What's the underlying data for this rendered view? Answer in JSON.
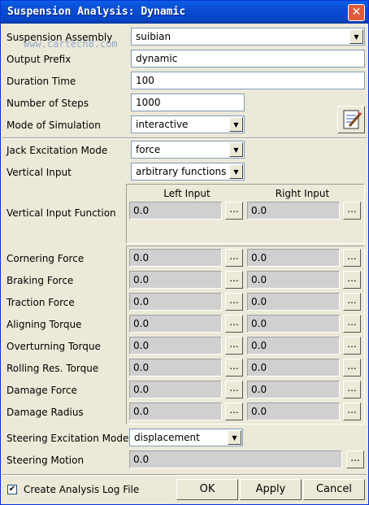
{
  "window": {
    "title": "Suspension Analysis: Dynamic",
    "close_glyph": "✕"
  },
  "watermark": "www.cartech8.com",
  "form": {
    "suspension_assembly": {
      "label": "Suspension Assembly",
      "value": "suibian"
    },
    "output_prefix": {
      "label": "Output Prefix",
      "value": "dynamic"
    },
    "duration_time": {
      "label": "Duration Time",
      "value": "100"
    },
    "number_of_steps": {
      "label": "Number of Steps",
      "value": "1000"
    },
    "mode_of_simulation": {
      "label": "Mode of Simulation",
      "value": "interactive"
    },
    "jack_excitation_mode": {
      "label": "Jack Excitation Mode",
      "value": "force"
    },
    "vertical_input": {
      "label": "Vertical Input",
      "value": "arbitrary functions"
    },
    "vertical_input_function": {
      "label": "Vertical Input Function",
      "left": "0.0",
      "right": "0.0"
    },
    "columns": {
      "left": "Left Input",
      "right": "Right Input"
    },
    "loads": [
      {
        "label": "Cornering Force",
        "left": "0.0",
        "right": "0.0"
      },
      {
        "label": "Braking Force",
        "left": "0.0",
        "right": "0.0"
      },
      {
        "label": "Traction Force",
        "left": "0.0",
        "right": "0.0"
      },
      {
        "label": "Aligning Torque",
        "left": "0.0",
        "right": "0.0"
      },
      {
        "label": "Overturning Torque",
        "left": "0.0",
        "right": "0.0"
      },
      {
        "label": "Rolling Res. Torque",
        "left": "0.0",
        "right": "0.0"
      },
      {
        "label": "Damage Force",
        "left": "0.0",
        "right": "0.0"
      },
      {
        "label": "Damage Radius",
        "left": "0.0",
        "right": "0.0"
      }
    ],
    "steering_excitation_mode": {
      "label": "Steering Excitation Mode",
      "value": "displacement"
    },
    "steering_motion": {
      "label": "Steering Motion",
      "value": "0.0"
    },
    "dots_label": "...",
    "combo_arrow": "▼"
  },
  "footer": {
    "log_checkbox": {
      "label": "Create Analysis Log File",
      "checked": true,
      "glyph": "✔"
    },
    "ok_label": "OK",
    "apply_label": "Apply",
    "cancel_label": "Cancel"
  },
  "icons": {
    "edit": "notepad-edit-icon"
  }
}
